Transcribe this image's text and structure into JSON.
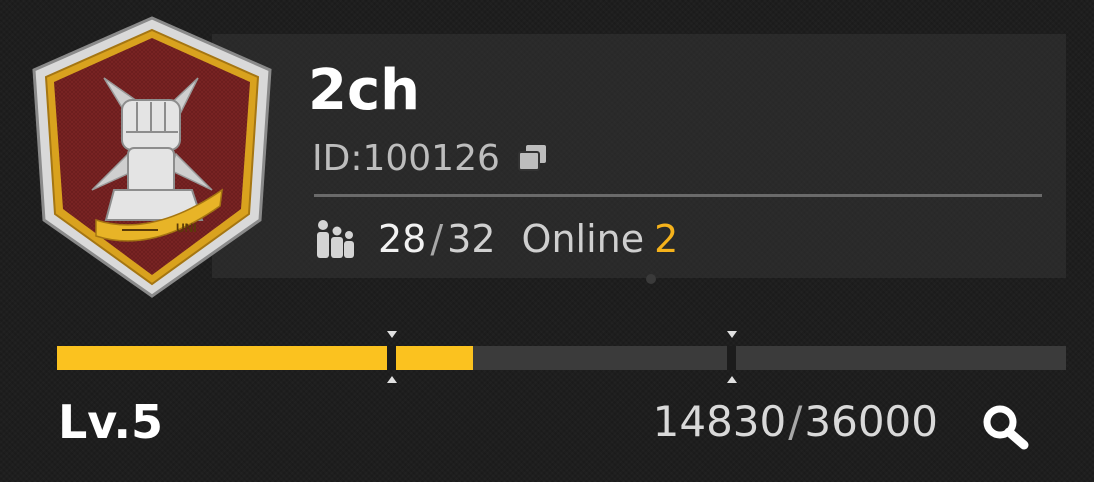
{
  "clan": {
    "name": "2ch",
    "id_label": "ID:",
    "id_value": "100126",
    "emblem_text": "UNI"
  },
  "members": {
    "current": "28",
    "separator": "/",
    "max": "32",
    "online_label": "Online",
    "online_count": "2"
  },
  "level": {
    "label": "Lv.5",
    "exp_current": "14830",
    "exp_separator": "/",
    "exp_max": "36000",
    "progress_fraction": 0.412
  },
  "icons": {
    "copy": "copy-icon",
    "members": "members-icon",
    "search": "search-icon"
  },
  "colors": {
    "accent": "#fbc21f",
    "online": "#f5b21b",
    "emblem_red": "#7a2424",
    "emblem_gold": "#d9a21e"
  }
}
